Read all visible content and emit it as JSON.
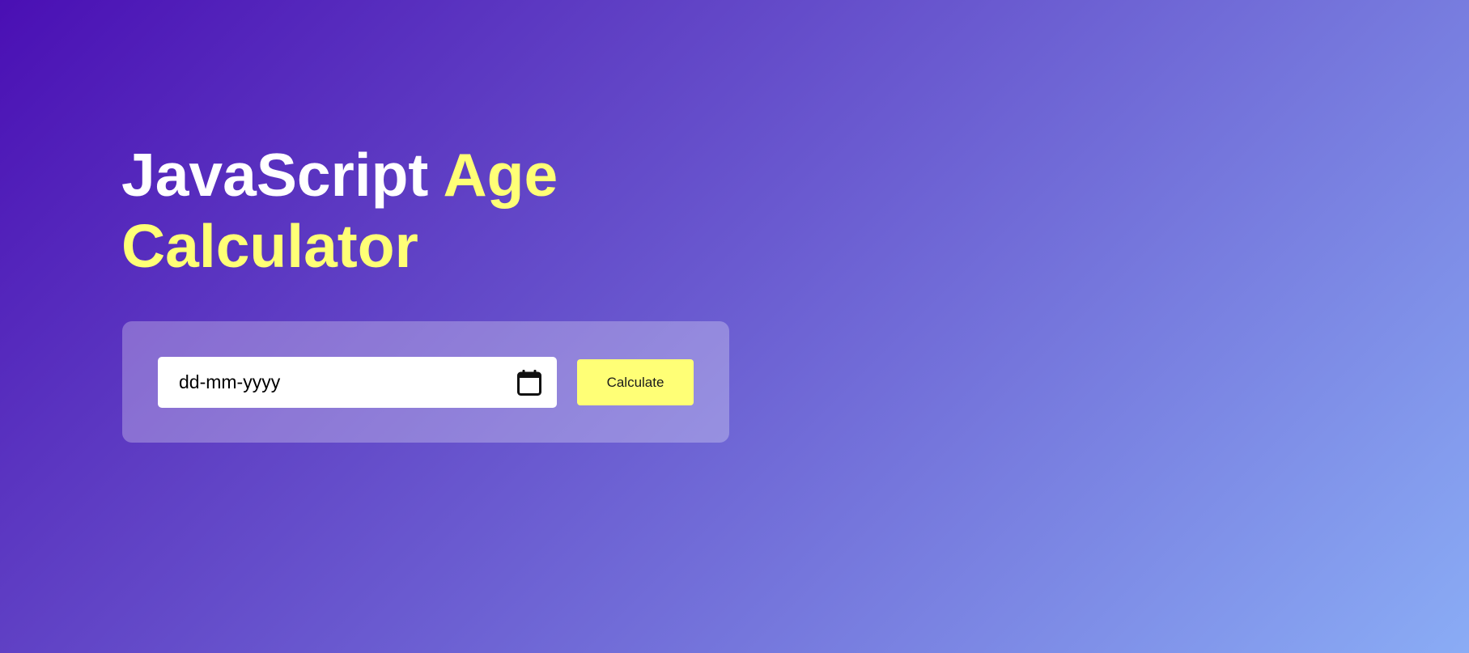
{
  "header": {
    "title_part1": "JavaScript",
    "title_part2": "Age",
    "title_part3": "Calculator"
  },
  "form": {
    "date_placeholder": "dd-mm-yyyy",
    "calculate_label": "Calculate"
  },
  "icons": {
    "calendar": "calendar-icon"
  },
  "colors": {
    "accent": "#ffff76",
    "gradient_start": "#4a0fb4",
    "gradient_end": "#8aacf5",
    "text_primary": "#ffffff"
  }
}
